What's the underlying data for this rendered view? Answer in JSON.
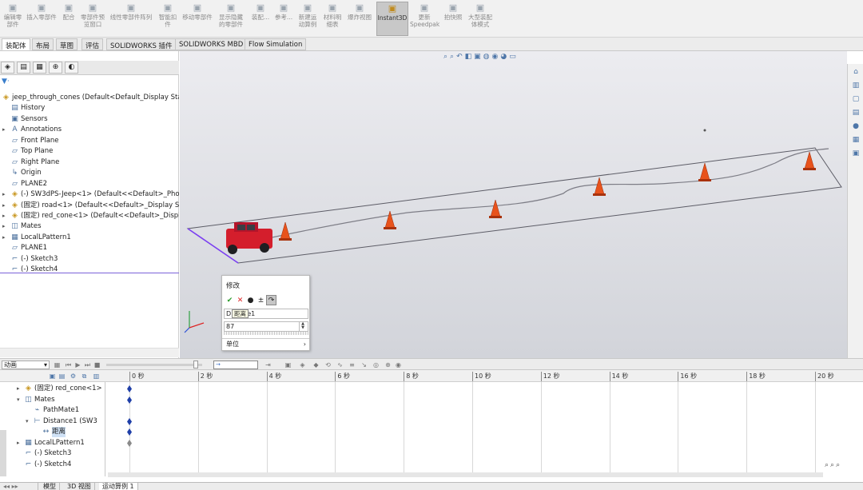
{
  "ribbon": {
    "buttons": [
      {
        "label": "编辑零\n部件",
        "icon": "edit-component-icon"
      },
      {
        "label": "插入零部件",
        "icon": "insert-component-icon"
      },
      {
        "label": "配合",
        "icon": "mate-icon"
      },
      {
        "label": "零部件预\n览窗口",
        "icon": "component-preview-icon"
      },
      {
        "label": "线性零部件阵列",
        "icon": "linear-pattern-icon"
      },
      {
        "label": "智能扣\n件",
        "icon": "smart-fastener-icon"
      },
      {
        "label": "移动零部件",
        "icon": "move-component-icon"
      },
      {
        "label": "显示隐藏\n的零部件",
        "icon": "show-hidden-icon"
      },
      {
        "label": "装配...",
        "icon": "assembly-feature-icon"
      },
      {
        "label": "参考...",
        "icon": "reference-geometry-icon"
      },
      {
        "label": "新建运\n动算例",
        "icon": "new-motion-study-icon"
      },
      {
        "label": "材料明\n细表",
        "icon": "bom-icon"
      },
      {
        "label": "爆炸视图",
        "icon": "exploded-view-icon"
      },
      {
        "label": "Instant3D",
        "icon": "instant3d-icon",
        "active": true
      },
      {
        "label": "更新\nSpeedpak",
        "icon": "speedpak-icon"
      },
      {
        "label": "拍快照",
        "icon": "snapshot-icon"
      },
      {
        "label": "大型装配\n体模式",
        "icon": "large-assembly-icon"
      }
    ]
  },
  "tabs": [
    "装配体",
    "布局",
    "草图",
    "评估",
    "SOLIDWORKS 插件",
    "SOLIDWORKS MBD",
    "Flow Simulation"
  ],
  "tree": [
    {
      "label": "jeep_through_cones  (Default<Default_Display State",
      "icon": "assembly-icon",
      "indent": 0,
      "arrow": ""
    },
    {
      "label": "History",
      "icon": "history-icon",
      "indent": 1,
      "arrow": ""
    },
    {
      "label": "Sensors",
      "icon": "sensors-icon",
      "indent": 1,
      "arrow": ""
    },
    {
      "label": "Annotations",
      "icon": "annotations-icon",
      "indent": 1,
      "arrow": "▸"
    },
    {
      "label": "Front Plane",
      "icon": "plane-icon",
      "indent": 1,
      "arrow": ""
    },
    {
      "label": "Top Plane",
      "icon": "plane-icon",
      "indent": 1,
      "arrow": ""
    },
    {
      "label": "Right Plane",
      "icon": "plane-icon",
      "indent": 1,
      "arrow": ""
    },
    {
      "label": "Origin",
      "icon": "origin-icon",
      "indent": 1,
      "arrow": ""
    },
    {
      "label": "PLANE2",
      "icon": "plane-icon",
      "indent": 1,
      "arrow": ""
    },
    {
      "label": "(-) SW3dPS-Jeep<1> (Default<<Default>_Photo",
      "icon": "part-icon",
      "indent": 1,
      "arrow": "▸"
    },
    {
      "label": "(固定) road<1> (Default<<Default>_Display Stat",
      "icon": "part-icon",
      "indent": 1,
      "arrow": "▸"
    },
    {
      "label": "(固定) red_cone<1> (Default<<Default>_Display",
      "icon": "part-icon",
      "indent": 1,
      "arrow": "▸"
    },
    {
      "label": "Mates",
      "icon": "mates-icon",
      "indent": 1,
      "arrow": "▸"
    },
    {
      "label": "LocalLPattern1",
      "icon": "pattern-icon",
      "indent": 1,
      "arrow": "▸"
    },
    {
      "label": "PLANE1",
      "icon": "plane-icon",
      "indent": 1,
      "arrow": ""
    },
    {
      "label": "(-) Sketch3",
      "icon": "sketch-icon",
      "indent": 1,
      "arrow": ""
    },
    {
      "label": "(-) Sketch4",
      "icon": "sketch-icon",
      "indent": 1,
      "arrow": ""
    }
  ],
  "modify": {
    "title": "修改",
    "name_field": "D1@     ce1",
    "tooltip": "距离",
    "value": "87",
    "units_label": "单位"
  },
  "motion": {
    "study_type": "动画",
    "ticks": [
      "0 秒",
      "2 秒",
      "4 秒",
      "6 秒",
      "8 秒",
      "10 秒",
      "12 秒",
      "14 秒",
      "16 秒",
      "18 秒",
      "20 秒"
    ],
    "rows": [
      {
        "label": "(固定) red_cone<1>",
        "icon": "part-icon",
        "indent": 3,
        "arrow": "▸",
        "key": "blue"
      },
      {
        "label": "Mates",
        "icon": "mates-icon",
        "indent": 3,
        "arrow": "▾",
        "key": "blue"
      },
      {
        "label": "PathMate1",
        "icon": "path-mate-icon",
        "indent": 5,
        "arrow": "",
        "key": ""
      },
      {
        "label": "Distance1 (SW3",
        "icon": "distance-mate-icon",
        "indent": 5,
        "arrow": "▾",
        "key": "blue"
      },
      {
        "label": "距离",
        "icon": "distance-icon",
        "indent": 7,
        "arrow": "",
        "key": "blue",
        "selected": true
      },
      {
        "label": "LocalLPattern1",
        "icon": "pattern-icon",
        "indent": 3,
        "arrow": "▸",
        "key": "gray"
      },
      {
        "label": "(-) Sketch3",
        "icon": "sketch-icon",
        "indent": 3,
        "arrow": "",
        "key": ""
      },
      {
        "label": "(-) Sketch4",
        "icon": "sketch-icon",
        "indent": 3,
        "arrow": "",
        "key": ""
      }
    ]
  },
  "bottom_tabs": [
    "模型",
    "3D 视图",
    "运动算例 1"
  ],
  "colors": {
    "accent": "#3a6fc9",
    "cone": "#e8531c",
    "jeep": "#d41e2c",
    "path": "#7d7d86",
    "key_blue": "#1f3fa8",
    "key_gray": "#8a8a8a"
  }
}
